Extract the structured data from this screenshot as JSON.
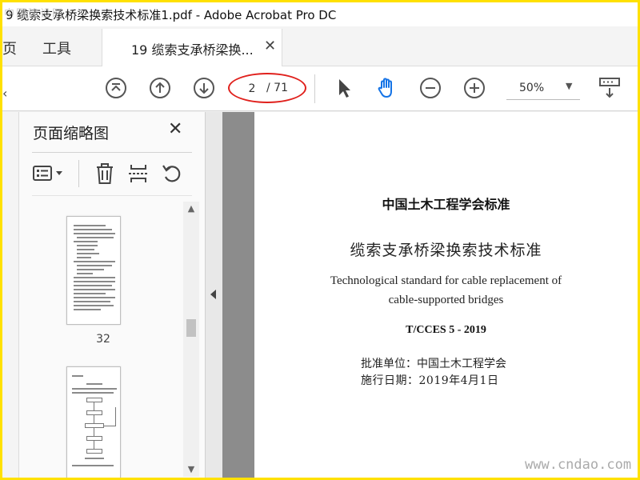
{
  "window": {
    "title": "9 缆索支承桥梁换索技术标准1.pdf - Adobe Acrobat Pro DC",
    "watermark_tl": "中国建设网"
  },
  "tabs": {
    "home_partial": "页",
    "tools": "工具",
    "doc_tab": "19 缆索支承桥梁换...",
    "close_glyph": "✕"
  },
  "toolbar": {
    "current_page": "2",
    "total_pages": "/ 71",
    "zoom": "50%",
    "zoom_caret": "▼",
    "left_arrow_glyph": "‹"
  },
  "panel": {
    "title": "页面缩略图",
    "close_glyph": "✕",
    "thumb_label_32": "32",
    "scroll_up": "▲",
    "scroll_down": "▼"
  },
  "document": {
    "org": "中国土木工程学会标准",
    "title": "缆索支承桥梁换索技术标准",
    "title_en_line1": "Technological standard for cable replacement of",
    "title_en_line2": "cable-supported bridges",
    "code": "T/CCES 5 - 2019",
    "approved_by": "批准单位：中国土木工程学会",
    "effective_date": "施行日期：2019年4月1日"
  },
  "watermark_br": "www.cndao.com",
  "colors": {
    "frame": "#ffe100",
    "accent_hand": "#1473e6",
    "annotation_ring": "#e0201c"
  }
}
